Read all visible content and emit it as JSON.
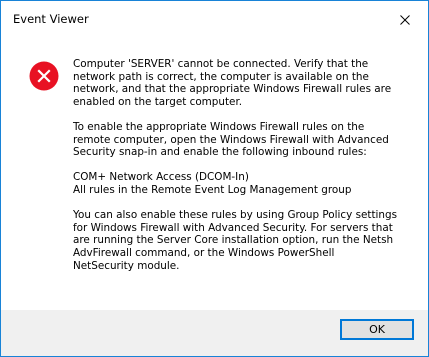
{
  "window": {
    "title": "Event Viewer"
  },
  "icons": {
    "error": "error-icon",
    "close": "close-icon"
  },
  "colors": {
    "error_red": "#e81123",
    "window_border": "#1883d7",
    "button_focus": "#0078d7",
    "footer_bg": "#f0f0f0"
  },
  "message": {
    "paragraphs": [
      "Computer 'SERVER' cannot be connected. Verify that the\nnetwork path is correct, the computer is available on the\nnetwork, and that the appropriate Windows Firewall rules are\nenabled on the target computer.",
      "To enable the appropriate Windows Firewall rules on the\nremote computer, open the Windows Firewall with Advanced\nSecurity snap-in and enable the following inbound rules:",
      "COM+ Network Access (DCOM-In)\nAll rules in the Remote Event Log Management group",
      "You can also enable these rules by using Group Policy settings\nfor Windows Firewall with Advanced Security. For servers that\nare running the Server Core installation option, run the Netsh\nAdvFirewall command, or the Windows PowerShell\nNetSecurity module."
    ]
  },
  "buttons": {
    "ok_label": "OK"
  }
}
